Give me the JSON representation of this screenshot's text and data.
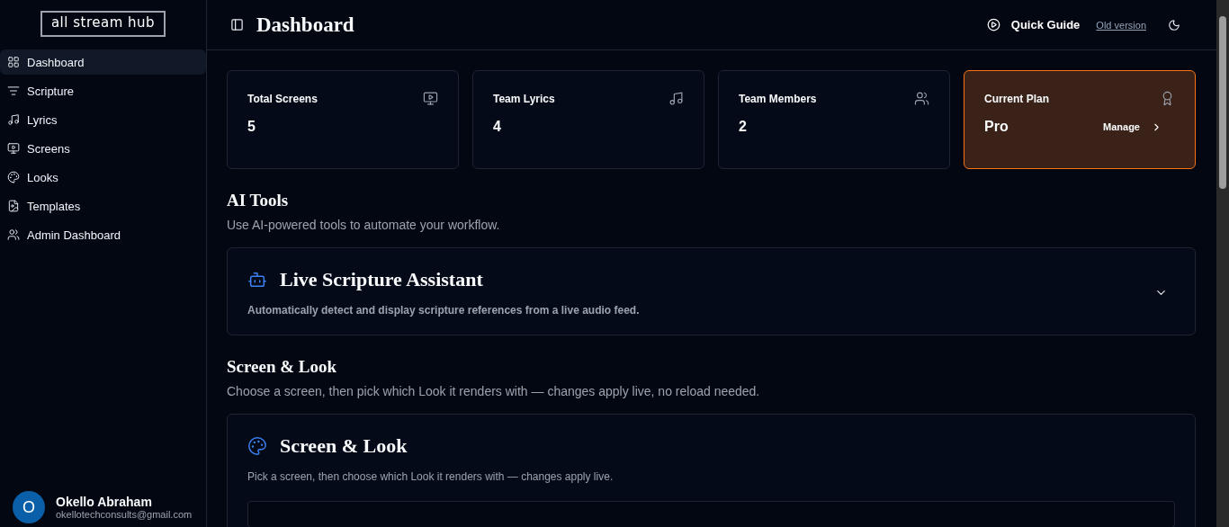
{
  "sidebar": {
    "logo": "all stream hub",
    "items": [
      {
        "label": "Dashboard",
        "selected": true
      },
      {
        "label": "Scripture",
        "selected": false
      },
      {
        "label": "Lyrics",
        "selected": false
      },
      {
        "label": "Screens",
        "selected": false
      },
      {
        "label": "Looks",
        "selected": false
      },
      {
        "label": "Templates",
        "selected": false
      },
      {
        "label": "Admin Dashboard",
        "selected": false
      }
    ],
    "user": {
      "initial": "O",
      "name": "Okello Abraham",
      "email": "okellotechconsults@gmail.com"
    }
  },
  "header": {
    "title": "Dashboard",
    "quick_guide": "Quick Guide",
    "old_version": "Old version"
  },
  "stats": [
    {
      "kind": "stat",
      "label": "Total Screens",
      "value": "5"
    },
    {
      "kind": "stat",
      "label": "Team Lyrics",
      "value": "4"
    },
    {
      "kind": "stat",
      "label": "Team Members",
      "value": "2"
    },
    {
      "kind": "plan",
      "label": "Current Plan",
      "value": "Pro",
      "action": "Manage"
    }
  ],
  "ai_tools": {
    "title": "AI Tools",
    "subtitle": "Use AI-powered tools to automate your workflow.",
    "card": {
      "title": "Live Scripture Assistant",
      "description": "Automatically detect and display scripture references from a live audio feed.",
      "expanded": false
    }
  },
  "screen_look": {
    "title": "Screen & Look",
    "subtitle": "Choose a screen, then pick which Look it renders with — changes apply live, no reload needed.",
    "card": {
      "title": "Screen & Look",
      "description": "Pick a screen, then choose which Look it renders with — changes apply live."
    }
  }
}
